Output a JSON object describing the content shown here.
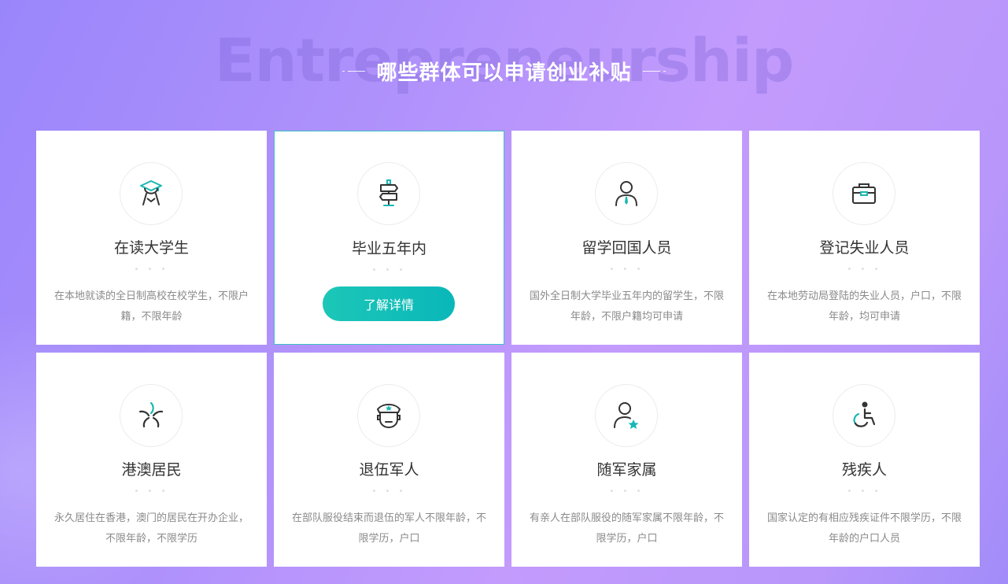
{
  "header": {
    "watermark": "Entrepreneurship",
    "title": "哪些群体可以申请创业补贴"
  },
  "cards": [
    {
      "title": "在读大学生",
      "desc": "在本地就读的全日制高校在校学生，不限户籍，不限年龄",
      "icon": "graduate-icon"
    },
    {
      "title": "毕业五年内",
      "button": "了解详情",
      "icon": "signpost-icon"
    },
    {
      "title": "留学回国人员",
      "desc": "国外全日制大学毕业五年内的留学生，不限年龄，不限户籍均可申请",
      "icon": "business-person-icon"
    },
    {
      "title": "登记失业人员",
      "desc": "在本地劳动局登陆的失业人员，户口，不限年龄，均可申请",
      "icon": "briefcase-icon"
    },
    {
      "title": "港澳居民",
      "desc": "永久居住在香港，澳门的居民在开办企业，不限年龄，不限学历",
      "icon": "bauhinia-flower-icon"
    },
    {
      "title": "退伍军人",
      "desc": "在部队服役结束而退伍的军人不限年龄，不限学历，户口",
      "icon": "soldier-icon"
    },
    {
      "title": "随军家属",
      "desc": "有亲人在部队服役的随军家属不限年龄，不限学历，户口",
      "icon": "person-star-icon"
    },
    {
      "title": "残疾人",
      "desc": "国家认定的有相应残疾证件不限学历，不限年龄的户口人员",
      "icon": "wheelchair-icon"
    }
  ],
  "dots": "• • •",
  "colors": {
    "accent": "#0ab7b9",
    "title_text": "#333333",
    "desc_text": "#8a8a8a"
  }
}
